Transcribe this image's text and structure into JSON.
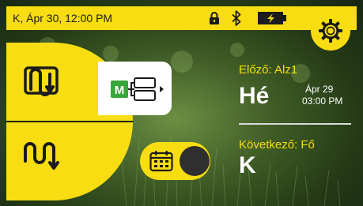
{
  "status_bar": {
    "datetime": "K, Ápr 30, 12:00 PM",
    "icons": [
      "lock-icon",
      "bluetooth-icon",
      "battery-charging-icon"
    ]
  },
  "settings_button": {
    "icon": "gear-icon"
  },
  "mode_selector": {
    "top_icon": "loop-mode-icon",
    "bottom_icon": "wave-mode-icon"
  },
  "module_card": {
    "badge": "M",
    "icon": "module-icon"
  },
  "schedule_toggle": {
    "icon": "calendar-icon",
    "state": "off"
  },
  "previous": {
    "label": "Előző: Alz1",
    "day": "Hé",
    "date": "Ápr 29",
    "time": "03:00 PM"
  },
  "next": {
    "label": "Következő: Fő",
    "day": "K"
  },
  "colors": {
    "accent": "#f7dd12",
    "badge_green": "#3aa53a",
    "dark": "#1b1b1b"
  }
}
